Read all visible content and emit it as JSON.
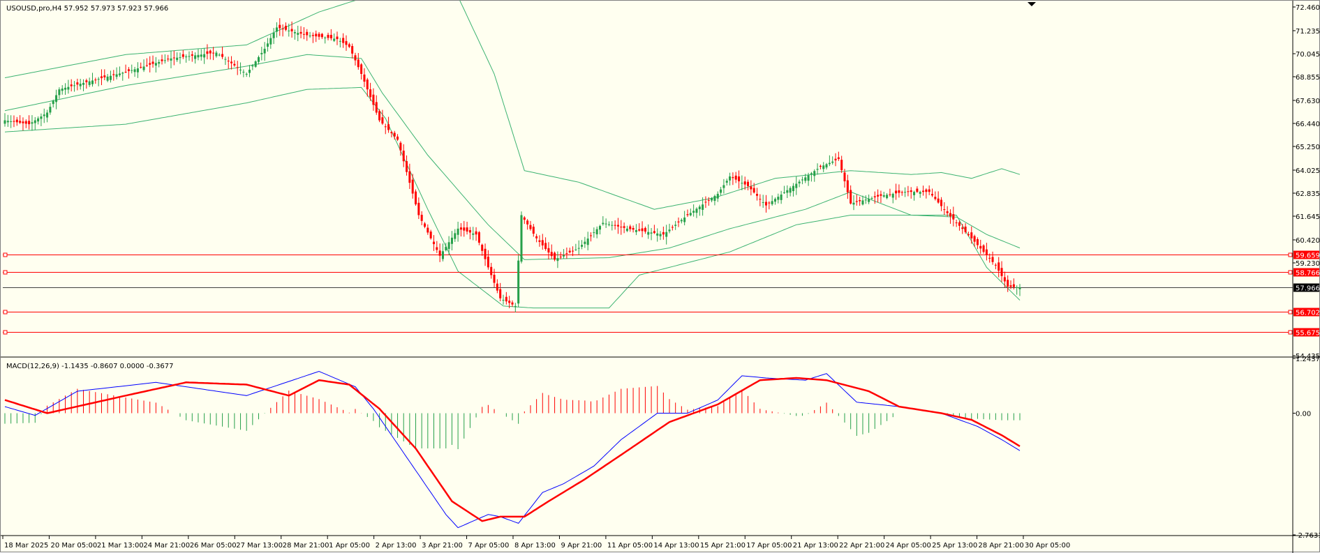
{
  "symbol_info": "USOUSD,pro,H4  57.952 57.973 57.923 57.966",
  "macd_info": "MACD(12,26,9) -1.1435 -0.8607 0.0000 -0.3677",
  "colors": {
    "background": "#fffff0",
    "bull": "#26a04a",
    "bear": "#ff0000",
    "bands": "#3cb371",
    "macd": "#0000ff",
    "signal": "#ff0000",
    "level_line": "#ff0000",
    "current_price_bg": "#000000"
  },
  "chart_data": [
    {
      "type": "candlestick",
      "title": "USOUSD,pro,H4",
      "ohlc_last": {
        "open": 57.952,
        "high": 57.973,
        "low": 57.923,
        "close": 57.966
      },
      "y_ticks": [
        "72.460",
        "71.235",
        "70.045",
        "68.855",
        "67.630",
        "66.440",
        "65.250",
        "64.025",
        "62.835",
        "61.645",
        "60.420",
        "59.230",
        "54.435"
      ],
      "ylim": [
        54.435,
        72.46
      ],
      "x_ticks": [
        "18 Mar 2025",
        "20 Mar 05:00",
        "21 Mar 13:00",
        "24 Mar 21:00",
        "26 Mar 05:00",
        "27 Mar 13:00",
        "28 Mar 21:00",
        "1 Apr 05:00",
        "2 Apr 13:00",
        "3 Apr 21:00",
        "7 Apr 05:00",
        "8 Apr 13:00",
        "9 Apr 21:00",
        "11 Apr 05:00",
        "14 Apr 13:00",
        "15 Apr 21:00",
        "17 Apr 05:00",
        "21 Apr 13:00",
        "22 Apr 21:00",
        "24 Apr 05:00",
        "25 Apr 13:00",
        "28 Apr 21:00",
        "30 Apr 05:00"
      ],
      "horizontal_levels": [
        {
          "value": 59.659,
          "label": "59.659"
        },
        {
          "value": 58.766,
          "label": "58.766"
        },
        {
          "value": 56.702,
          "label": "56.702"
        },
        {
          "value": 55.675,
          "label": "55.675"
        }
      ],
      "current_price": {
        "value": 57.966,
        "label": "57.966"
      },
      "close_keypoints": [
        [
          0,
          66.6
        ],
        [
          8,
          66.4
        ],
        [
          14,
          67.0
        ],
        [
          18,
          68.2
        ],
        [
          30,
          68.7
        ],
        [
          40,
          69.1
        ],
        [
          55,
          69.8
        ],
        [
          70,
          70.1
        ],
        [
          80,
          69.0
        ],
        [
          86,
          70.3
        ],
        [
          90,
          71.4
        ],
        [
          100,
          71.0
        ],
        [
          110,
          70.8
        ],
        [
          114,
          70.4
        ],
        [
          118,
          69.0
        ],
        [
          124,
          66.6
        ],
        [
          130,
          65.6
        ],
        [
          137,
          61.7
        ],
        [
          144,
          59.6
        ],
        [
          150,
          61.0
        ],
        [
          156,
          60.7
        ],
        [
          160,
          59.0
        ],
        [
          164,
          57.4
        ],
        [
          169,
          57.0
        ],
        [
          171,
          61.7
        ],
        [
          176,
          60.5
        ],
        [
          182,
          59.4
        ],
        [
          190,
          60.0
        ],
        [
          198,
          61.3
        ],
        [
          206,
          61.0
        ],
        [
          218,
          60.7
        ],
        [
          226,
          61.7
        ],
        [
          236,
          62.8
        ],
        [
          240,
          63.7
        ],
        [
          246,
          63.2
        ],
        [
          252,
          62.2
        ],
        [
          260,
          63.1
        ],
        [
          270,
          64.2
        ],
        [
          276,
          64.6
        ],
        [
          280,
          62.3
        ],
        [
          290,
          62.7
        ],
        [
          298,
          62.9
        ],
        [
          306,
          62.9
        ],
        [
          312,
          61.8
        ],
        [
          320,
          60.5
        ],
        [
          328,
          59.1
        ],
        [
          332,
          58.0
        ],
        [
          336,
          57.96
        ]
      ],
      "bands_upper": [
        [
          0,
          68.8
        ],
        [
          40,
          70.0
        ],
        [
          80,
          70.5
        ],
        [
          104,
          72.2
        ],
        [
          120,
          73.0
        ],
        [
          150,
          73.0
        ],
        [
          162,
          69.0
        ],
        [
          172,
          64.0
        ],
        [
          190,
          63.4
        ],
        [
          215,
          62.0
        ],
        [
          235,
          62.6
        ],
        [
          255,
          63.6
        ],
        [
          280,
          64.0
        ],
        [
          300,
          63.8
        ],
        [
          310,
          63.9
        ],
        [
          320,
          63.6
        ],
        [
          330,
          64.1
        ],
        [
          336,
          63.8
        ]
      ],
      "bands_middle": [
        [
          0,
          67.1
        ],
        [
          40,
          68.4
        ],
        [
          80,
          69.4
        ],
        [
          100,
          70.0
        ],
        [
          118,
          69.8
        ],
        [
          125,
          68.0
        ],
        [
          140,
          64.8
        ],
        [
          160,
          61.2
        ],
        [
          172,
          59.4
        ],
        [
          200,
          59.5
        ],
        [
          220,
          60.0
        ],
        [
          240,
          61.0
        ],
        [
          265,
          62.0
        ],
        [
          280,
          62.9
        ],
        [
          300,
          61.7
        ],
        [
          315,
          61.6
        ],
        [
          325,
          60.7
        ],
        [
          336,
          60.0
        ]
      ],
      "bands_lower": [
        [
          0,
          66.0
        ],
        [
          40,
          66.4
        ],
        [
          80,
          67.5
        ],
        [
          100,
          68.2
        ],
        [
          118,
          68.3
        ],
        [
          126,
          66.7
        ],
        [
          140,
          62.0
        ],
        [
          150,
          58.8
        ],
        [
          165,
          57.0
        ],
        [
          175,
          56.9
        ],
        [
          200,
          56.9
        ],
        [
          210,
          58.6
        ],
        [
          220,
          59.0
        ],
        [
          240,
          59.8
        ],
        [
          262,
          61.2
        ],
        [
          280,
          61.7
        ],
        [
          300,
          61.7
        ],
        [
          315,
          61.7
        ],
        [
          325,
          59.0
        ],
        [
          336,
          57.3
        ]
      ]
    },
    {
      "type": "macd",
      "title": "MACD(12,26,9)",
      "values_last": {
        "main": -1.1435,
        "signal": -0.8607,
        "hist": 0.0,
        "osma": -0.3677
      },
      "y_ticks": [
        "1.2437",
        "0.00",
        "-2.7631"
      ],
      "ylim": [
        -2.7631,
        1.2437
      ],
      "main_keypoints": [
        [
          0,
          0.15
        ],
        [
          10,
          -0.05
        ],
        [
          24,
          0.5
        ],
        [
          50,
          0.7
        ],
        [
          80,
          0.4
        ],
        [
          104,
          0.95
        ],
        [
          116,
          0.6
        ],
        [
          122,
          0.1
        ],
        [
          135,
          -1.2
        ],
        [
          146,
          -2.3
        ],
        [
          150,
          -2.6
        ],
        [
          160,
          -2.3
        ],
        [
          164,
          -2.35
        ],
        [
          170,
          -2.5
        ],
        [
          178,
          -1.8
        ],
        [
          185,
          -1.6
        ],
        [
          195,
          -1.2
        ],
        [
          204,
          -0.6
        ],
        [
          216,
          0.0
        ],
        [
          226,
          0.0
        ],
        [
          236,
          0.3
        ],
        [
          244,
          0.85
        ],
        [
          252,
          0.8
        ],
        [
          265,
          0.75
        ],
        [
          272,
          0.9
        ],
        [
          282,
          0.25
        ],
        [
          296,
          0.15
        ],
        [
          310,
          0.0
        ],
        [
          322,
          -0.3
        ],
        [
          330,
          -0.6
        ],
        [
          336,
          -0.85
        ]
      ],
      "signal_keypoints": [
        [
          0,
          0.3
        ],
        [
          14,
          0.0
        ],
        [
          40,
          0.4
        ],
        [
          60,
          0.7
        ],
        [
          80,
          0.65
        ],
        [
          94,
          0.4
        ],
        [
          104,
          0.75
        ],
        [
          114,
          0.65
        ],
        [
          124,
          0.1
        ],
        [
          136,
          -0.8
        ],
        [
          148,
          -2.0
        ],
        [
          158,
          -2.45
        ],
        [
          164,
          -2.35
        ],
        [
          172,
          -2.35
        ],
        [
          180,
          -2.0
        ],
        [
          192,
          -1.5
        ],
        [
          205,
          -0.9
        ],
        [
          220,
          -0.2
        ],
        [
          236,
          0.2
        ],
        [
          250,
          0.75
        ],
        [
          262,
          0.8
        ],
        [
          272,
          0.75
        ],
        [
          286,
          0.5
        ],
        [
          296,
          0.15
        ],
        [
          310,
          0.0
        ],
        [
          320,
          -0.15
        ],
        [
          330,
          -0.5
        ],
        [
          336,
          -0.75
        ]
      ]
    }
  ]
}
